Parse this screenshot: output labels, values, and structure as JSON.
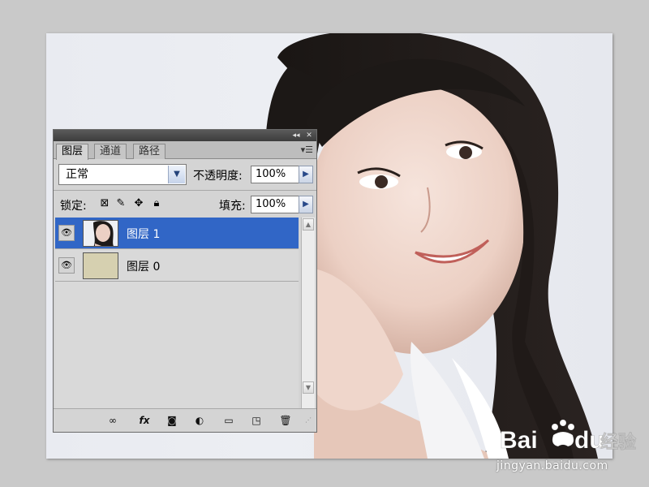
{
  "panel": {
    "tabs": [
      {
        "label": "图层",
        "active": true
      },
      {
        "label": "通道",
        "active": false
      },
      {
        "label": "路径",
        "active": false
      }
    ],
    "blend_mode": "正常",
    "opacity_label": "不透明度:",
    "opacity_value": "100%",
    "lock_label": "锁定:",
    "fill_label": "填充:",
    "fill_value": "100%",
    "layers": [
      {
        "name": "图层 1",
        "selected": true,
        "visible": true,
        "thumb": "portrait-photo"
      },
      {
        "name": "图层 0",
        "selected": false,
        "visible": true,
        "thumb": "beige-texture"
      }
    ],
    "footer_buttons": [
      "link-layers-icon",
      "fx-icon",
      "mask-icon",
      "adjustment-icon",
      "group-folder-icon",
      "new-layer-icon",
      "trash-icon"
    ],
    "fx_label": "fx"
  },
  "watermark": {
    "logo_text": "Bai du 经验",
    "url": "jingyan.baidu.com"
  },
  "colors": {
    "selection": "#3166c6",
    "panel_bg": "#d4d4d4",
    "workspace_bg": "#c9c9c9"
  }
}
